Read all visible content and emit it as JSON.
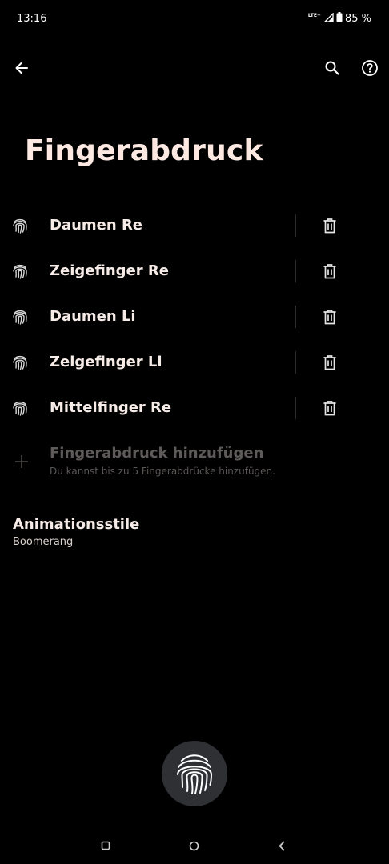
{
  "status_bar": {
    "time": "13:16",
    "network": "LTE+",
    "battery": "85 %"
  },
  "app_bar": {
    "back_icon": "arrow-back-icon",
    "search_icon": "search-icon",
    "help_icon": "help-circle-icon"
  },
  "page": {
    "title": "Fingerabdruck"
  },
  "fingerprints": [
    {
      "label": "Daumen Re"
    },
    {
      "label": "Zeigefinger Re"
    },
    {
      "label": "Daumen Li"
    },
    {
      "label": "Zeigefinger Li"
    },
    {
      "label": "Mittelfinger Re"
    }
  ],
  "add_fingerprint": {
    "title": "Fingerabdruck hinzufügen",
    "subtitle": "Du kannst bis zu 5 Fingerabdrücke hinzufügen."
  },
  "animation": {
    "title": "Animationsstile",
    "value": "Boomerang"
  },
  "colors": {
    "background": "#000000",
    "title": "#fde9e1",
    "text": "#f6ebe6",
    "disabled_text": "#5d5a59",
    "sensor": "#2e3034"
  }
}
